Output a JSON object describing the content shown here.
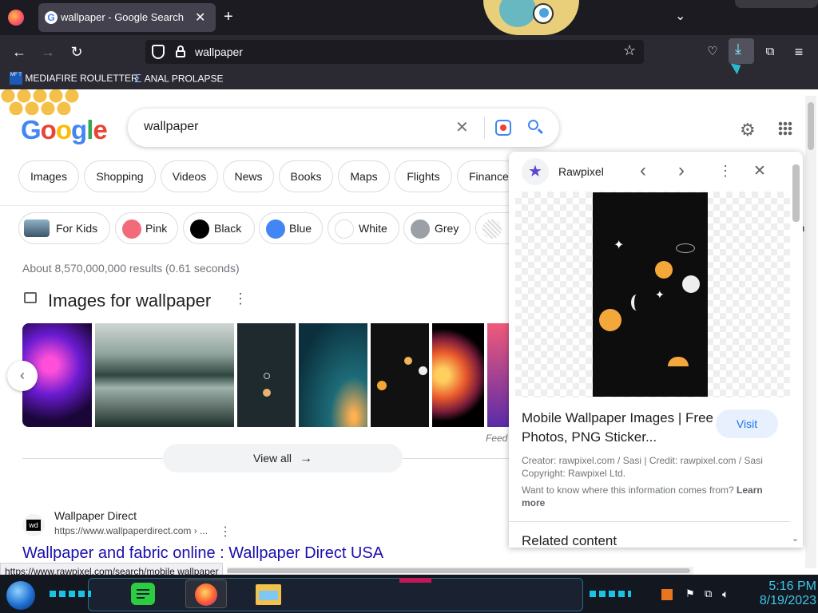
{
  "browser": {
    "tab_title": "wallpaper - Google Search",
    "url": "wallpaper",
    "bookmarks": [
      "MEDIAFIRE ROULETTER",
      "ANAL PROLAPSE"
    ]
  },
  "search": {
    "query": "wallpaper",
    "logo": "Google"
  },
  "tabs": [
    "Images",
    "Shopping",
    "Videos",
    "News",
    "Books",
    "Maps",
    "Flights",
    "Finance"
  ],
  "color_chips": [
    {
      "label": "For Kids",
      "color": "#6a7f8f"
    },
    {
      "label": "Pink",
      "color": "#f26b7a"
    },
    {
      "label": "Black",
      "color": "#000000"
    },
    {
      "label": "Blue",
      "color": "#4285f4"
    },
    {
      "label": "White",
      "color": "#ffffff"
    },
    {
      "label": "Grey",
      "color": "#9aa0a6"
    }
  ],
  "results_stats": "About 8,570,000,000 results (0.61 seconds)",
  "images_heading": "Images for wallpaper",
  "view_all": "View all",
  "feedback_partial": "Feed",
  "result": {
    "site_name": "Wallpaper Direct",
    "site_url": "https://www.wallpaperdirect.com › ...",
    "favicon_text": "wd",
    "title": "Wallpaper and fabric online : Wallpaper Direct USA"
  },
  "panel": {
    "source": "Rawpixel",
    "title": "Mobile Wallpaper Images | Free Photos, PNG Sticker...",
    "visit": "Visit",
    "credit": "Creator: rawpixel.com / Sasi | Credit: rawpixel.com / Sasi",
    "copyright": "Copyright: Rawpixel Ltd.",
    "info": "Want to know where this information comes from?",
    "learn_more": "Learn more",
    "related": "Related content"
  },
  "status_url": "https://www.rawpixel.com/search/mobile wallpaper",
  "taskbar": {
    "time": "5:16 PM",
    "date": "8/19/2023"
  }
}
